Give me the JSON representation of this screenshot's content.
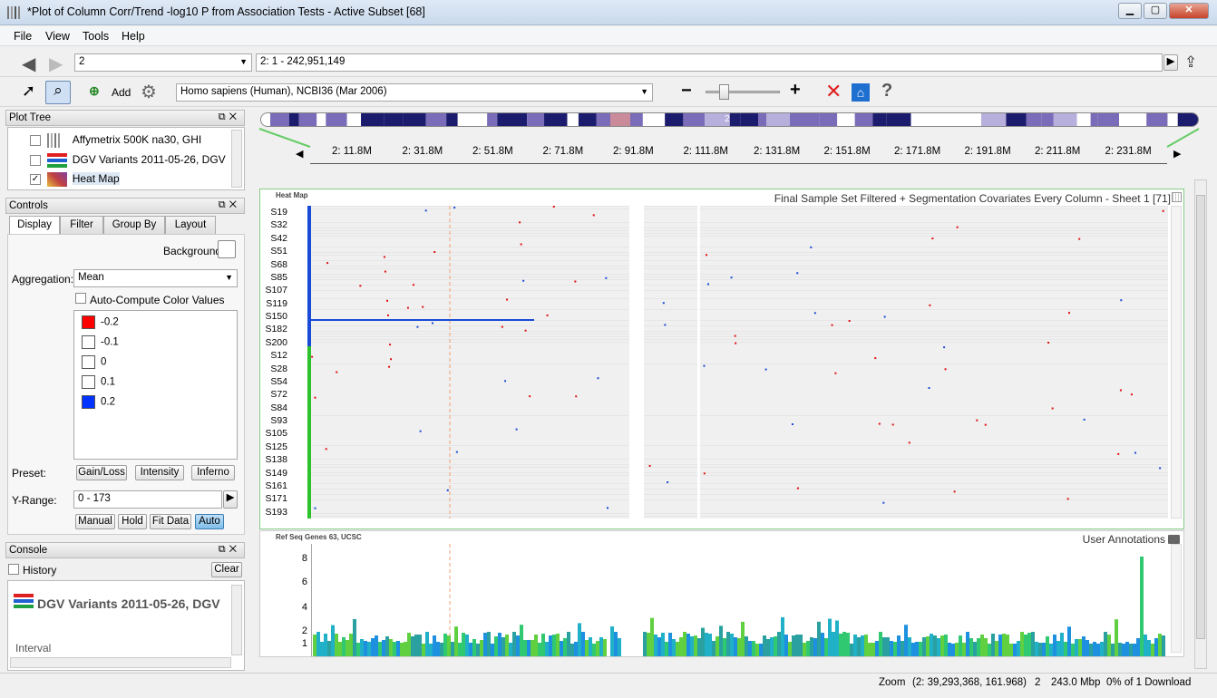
{
  "window": {
    "title": "*Plot of Column Corr/Trend  -log10 P from Association Tests - Active Subset [68]",
    "min": "▁",
    "max": "▢",
    "close": "✕"
  },
  "menu": [
    "File",
    "View",
    "Tools",
    "Help"
  ],
  "nav": {
    "chromosome": "2",
    "location": "2: 1 - 242,951,149"
  },
  "toolbar": {
    "add_label": "Add",
    "genome": "Homo sapiens (Human), NCBI36 (Mar 2006)",
    "zoom_minus": "−",
    "zoom_plus": "+",
    "help": "?",
    "zoom_level": 0.2
  },
  "plot_tree": {
    "title": "Plot Tree",
    "items": [
      {
        "label": "Affymetrix 500K na30, GHI",
        "checked": false
      },
      {
        "label": "DGV Variants 2011-05-26, DGV",
        "checked": false
      },
      {
        "label": "Heat Map",
        "checked": true
      }
    ]
  },
  "controls": {
    "title": "Controls",
    "tabs": [
      "Display",
      "Filter",
      "Group By",
      "Layout"
    ],
    "background_label": "Background",
    "aggregation_label": "Aggregation:",
    "aggregation_value": "Mean",
    "auto_compute_label": "Auto-Compute Color Values",
    "legend": [
      {
        "value": "-0.2",
        "color": "#ff0000"
      },
      {
        "value": "-0.1",
        "color": "#ffffff"
      },
      {
        "value": "0",
        "color": "#ffffff"
      },
      {
        "value": "0.1",
        "color": "#ffffff"
      },
      {
        "value": "0.2",
        "color": "#0033ff"
      }
    ],
    "preset_label": "Preset:",
    "presets": [
      "Gain/Loss",
      "Intensity",
      "Inferno"
    ],
    "yrange_label": "Y-Range:",
    "yrange_value": "0 - 173",
    "range_buttons": [
      "Manual",
      "Hold",
      "Fit Data",
      "Auto"
    ]
  },
  "console": {
    "title": "Console",
    "history_label": "History",
    "clear_label": "Clear",
    "heading": "DGV Variants 2011-05-26, DGV",
    "interval_label": "Interval"
  },
  "chromosome_label": "2",
  "axis_ticks": [
    "2: 11.8M",
    "2: 31.8M",
    "2: 51.8M",
    "2: 71.8M",
    "2: 91.8M",
    "2: 111.8M",
    "2: 131.8M",
    "2: 151.8M",
    "2: 171.8M",
    "2: 191.8M",
    "2: 211.8M",
    "2: 231.8M"
  ],
  "heatmap": {
    "tag": "Heat Map",
    "title": "Final Sample Set Filtered + Segmentation Covariates Every Column - Sheet 1 [71]",
    "samples": [
      "S19",
      "S32",
      "S42",
      "S51",
      "S68",
      "S85",
      "S107",
      "S119",
      "S150",
      "S182",
      "S200",
      "S12",
      "S28",
      "S54",
      "S72",
      "S84",
      "S93",
      "S105",
      "S125",
      "S138",
      "S149",
      "S161",
      "S171",
      "S193"
    ]
  },
  "genes": {
    "tag": "Ref Seq Genes 63, UCSC",
    "annotations": "User Annotations",
    "yticks": [
      "8",
      "6",
      "4",
      "2",
      "1"
    ]
  },
  "status": {
    "zoom": "Zoom",
    "coords": "(2: 39,293,368, 161.968)",
    "chrom": "2",
    "span": "243.0 Mbp",
    "download": "0% of 1 Download"
  }
}
